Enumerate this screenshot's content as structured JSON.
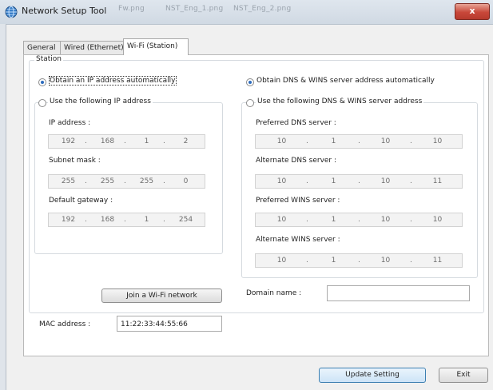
{
  "window": {
    "title": "Network Setup Tool",
    "close_glyph": "x",
    "background_tabs": [
      "Fw.png",
      "NST_Eng_1.png",
      "NST_Eng_2.png"
    ]
  },
  "tabs": [
    {
      "label": "General",
      "active": false
    },
    {
      "label": "Wired (Ethernet)",
      "active": false
    },
    {
      "label": "Wi-Fi (Station)",
      "active": true
    }
  ],
  "station": {
    "group_label": "Station",
    "ip": {
      "auto_label": "Obtain an IP address automatically",
      "manual_label": "Use the following IP address",
      "selected": "auto",
      "fields": [
        {
          "label": "IP address :",
          "octets": [
            "192",
            "168",
            "1",
            "2"
          ]
        },
        {
          "label": "Subnet mask :",
          "octets": [
            "255",
            "255",
            "255",
            "0"
          ]
        },
        {
          "label": "Default gateway :",
          "octets": [
            "192",
            "168",
            "1",
            "254"
          ]
        }
      ]
    },
    "dns": {
      "auto_label": "Obtain DNS & WINS server address automatically",
      "manual_label": "Use the following DNS & WINS server address",
      "selected": "auto",
      "fields": [
        {
          "label": "Preferred DNS server :",
          "octets": [
            "10",
            "1",
            "10",
            "10"
          ]
        },
        {
          "label": "Alternate DNS server :",
          "octets": [
            "10",
            "1",
            "10",
            "11"
          ]
        },
        {
          "label": "Preferred WINS server :",
          "octets": [
            "10",
            "1",
            "10",
            "10"
          ]
        },
        {
          "label": "Alternate WINS server :",
          "octets": [
            "10",
            "1",
            "10",
            "11"
          ]
        }
      ]
    },
    "join_button": "Join a Wi-Fi network",
    "domain_label": "Domain name :",
    "domain_value": "",
    "mac_label": "MAC address :",
    "mac_value": "11:22:33:44:55:66"
  },
  "footer": {
    "update_button": "Update Setting",
    "exit_button": "Exit"
  },
  "colors": {
    "accent": "#2c6bbd",
    "close_button": "#c8483a",
    "primary_button_border": "#3c7fb1"
  },
  "icons": {
    "app_icon": "network-globe-icon",
    "close_icon": "close-icon"
  }
}
